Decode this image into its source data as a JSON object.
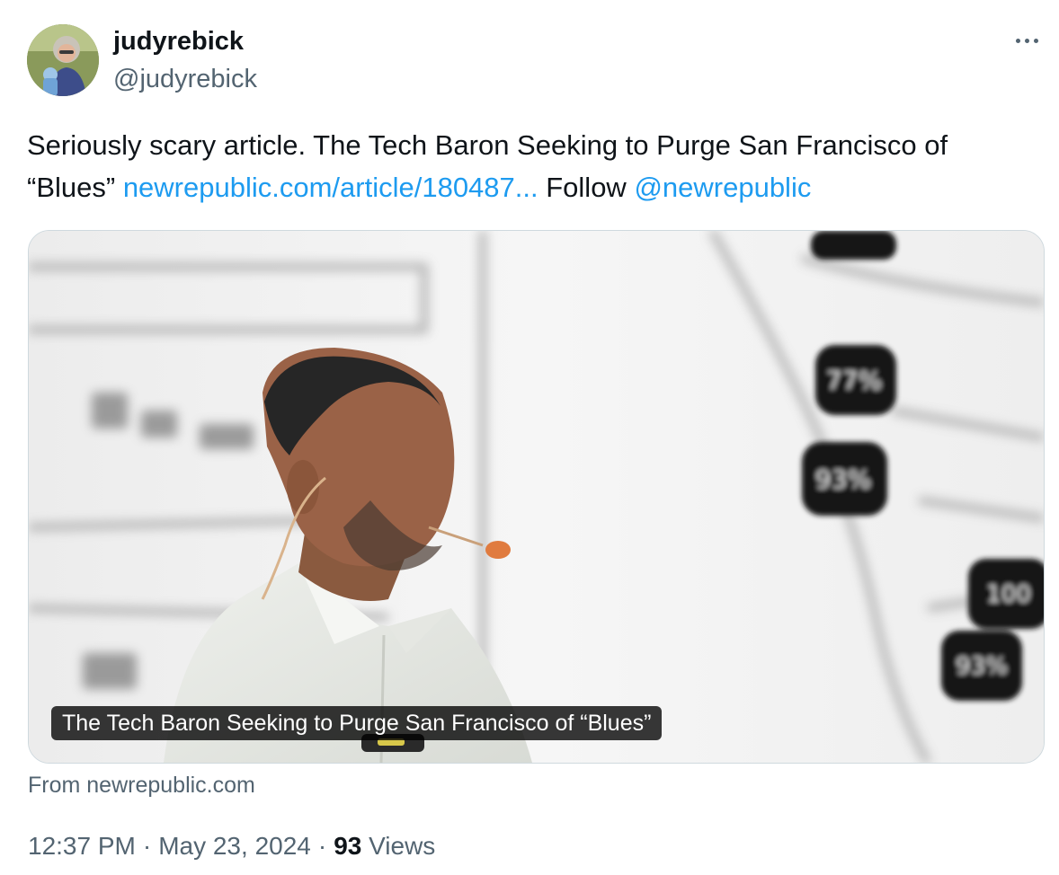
{
  "author": {
    "display_name": "judyrebick",
    "handle": "@judyrebick",
    "avatar_icon": "avatar-photo"
  },
  "more_icon": "more-horizontal-icon",
  "tweet": {
    "text_intro": "Seriously scary article. The Tech Baron Seeking to Purge San Francisco of “Blues” ",
    "link_text": "newrepublic.com/article/180487...",
    "text_mid": " Follow ",
    "mention": "@newrepublic"
  },
  "card": {
    "caption": "The Tech Baron Seeking to Purge San Francisco of “Blues”",
    "source": "From newrepublic.com"
  },
  "meta": {
    "time": "12:37 PM",
    "separator": "·",
    "date": "May 23, 2024",
    "views_count": "93",
    "views_label": "Views"
  },
  "colors": {
    "link": "#1d9bf0",
    "text": "#0f1419",
    "secondary": "#536471",
    "border": "#cfd9de"
  }
}
